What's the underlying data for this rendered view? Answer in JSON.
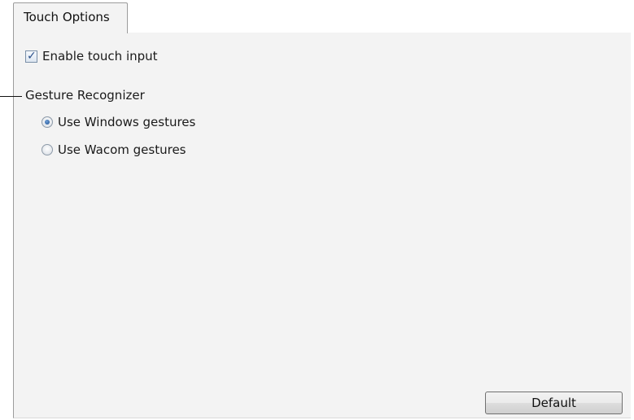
{
  "tabs": [
    {
      "label": "Touch Options"
    }
  ],
  "touch": {
    "enable_label": "Enable touch input",
    "enable_checked": true
  },
  "gesture": {
    "group_label": "Gesture Recognizer",
    "options": [
      {
        "label": "Use Windows gestures",
        "selected": true
      },
      {
        "label": "Use Wacom gestures",
        "selected": false
      }
    ]
  },
  "buttons": {
    "default_label": "Default"
  },
  "icons": {
    "checkbox_mark": "checkmark-icon",
    "radio_selected": "radio-dot-icon"
  },
  "colors": {
    "panel_bg": "#f3f3f3",
    "accent": "#1e4f90"
  }
}
